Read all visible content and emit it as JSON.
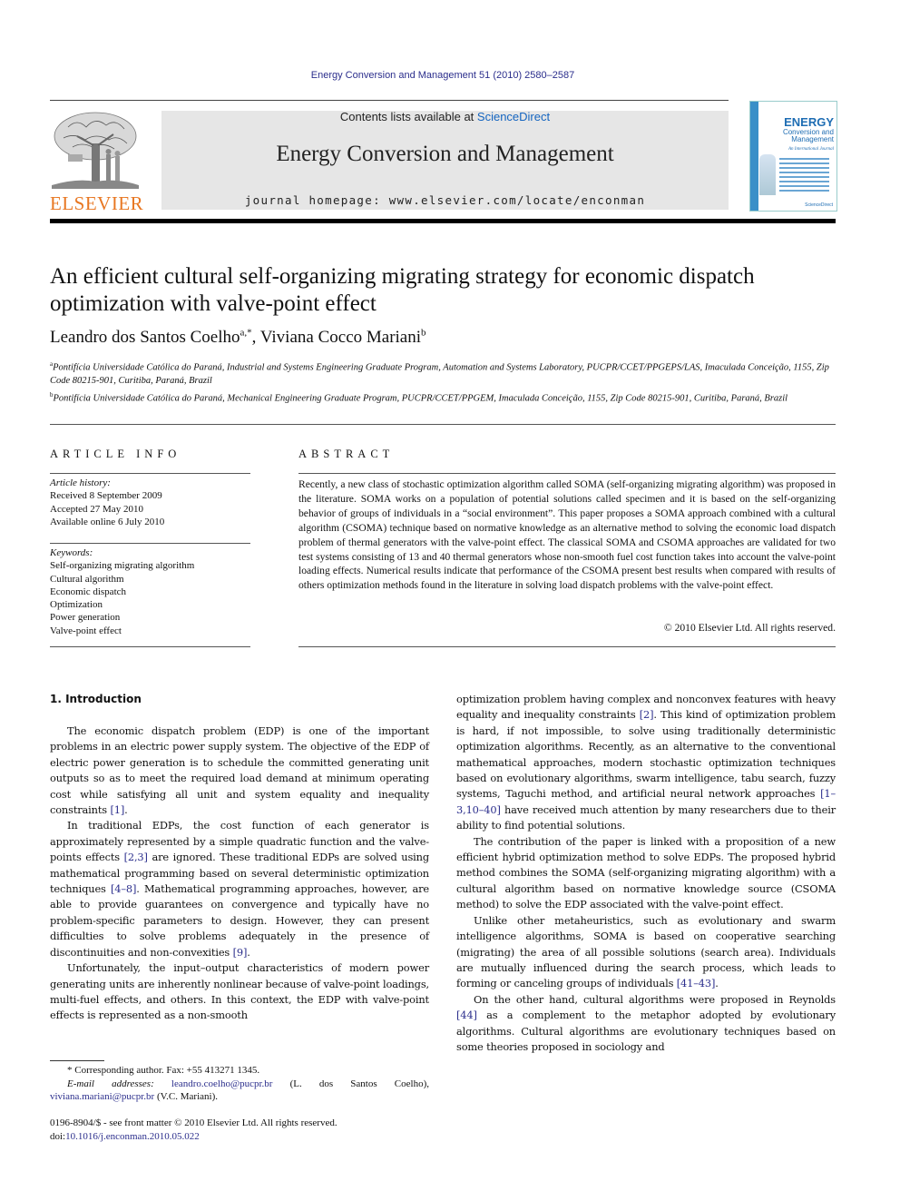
{
  "header": {
    "journal_reference": "Energy Conversion and Management 51 (2010) 2580–2587",
    "contents_prefix": "Contents lists available at ",
    "contents_link": "ScienceDirect",
    "journal_name": "Energy Conversion and Management",
    "homepage_label": "journal homepage: www.elsevier.com/locate/enconman",
    "publisher_logo_text": "ELSEVIER",
    "cover": {
      "title": "ENERGY",
      "subtitle_1": "Conversion and",
      "subtitle_2": "Management",
      "tagline": "An International Journal",
      "publisher_mark": "ScienceDirect"
    },
    "colors": {
      "link": "#2b2e8c",
      "sciencedirect": "#1565c0",
      "elsevier_orange": "#e87722",
      "masthead_bg": "#e6e6e6"
    }
  },
  "article": {
    "title": "An efficient cultural self-organizing migrating strategy for economic dispatch optimization with valve-point effect",
    "authors": [
      {
        "name": "Leandro dos Santos Coelho",
        "sup": "a,*"
      },
      {
        "name": "Viviana Cocco Mariani",
        "sup": "b"
      }
    ],
    "author_separator": ", ",
    "affiliations": [
      {
        "sup": "a",
        "text": "Pontifícia Universidade Católica do Paraná, Industrial and Systems Engineering Graduate Program, Automation and Systems Laboratory, PUCPR/CCET/PPGEPS/LAS, Imaculada Conceição, 1155, Zip Code 80215-901, Curitiba, Paraná, Brazil"
      },
      {
        "sup": "b",
        "text": "Pontifícia Universidade Católica do Paraná, Mechanical Engineering Graduate Program, PUCPR/CCET/PPGEM, Imaculada Conceição, 1155, Zip Code 80215-901, Curitiba, Paraná, Brazil"
      }
    ]
  },
  "article_info": {
    "heading": "ARTICLE INFO",
    "history_label": "Article history:",
    "history": [
      "Received 8 September 2009",
      "Accepted 27 May 2010",
      "Available online 6 July 2010"
    ],
    "keywords_label": "Keywords:",
    "keywords": [
      "Self-organizing migrating algorithm",
      "Cultural algorithm",
      "Economic dispatch",
      "Optimization",
      "Power generation",
      "Valve-point effect"
    ]
  },
  "abstract": {
    "heading": "ABSTRACT",
    "text": "Recently, a new class of stochastic optimization algorithm called SOMA (self-organizing migrating algorithm) was proposed in the literature. SOMA works on a population of potential solutions called specimen and it is based on the self-organizing behavior of groups of individuals in a “social environment”. This paper proposes a SOMA approach combined with a cultural algorithm (CSOMA) technique based on normative knowledge as an alternative method to solving the economic load dispatch problem of thermal generators with the valve-point effect. The classical SOMA and CSOMA approaches are validated for two test systems consisting of 13 and 40 thermal generators whose non-smooth fuel cost function takes into account the valve-point loading effects. Numerical results indicate that performance of the CSOMA present best results when compared with results of others optimization methods found in the literature in solving load dispatch problems with the valve-point effect.",
    "copyright": "© 2010 Elsevier Ltd. All rights reserved."
  },
  "introduction": {
    "heading": "1. Introduction",
    "left_paragraphs": [
      {
        "before": "The economic dispatch problem (EDP) is one of the important problems in an electric power supply system. The objective of the EDP of electric power generation is to schedule the committed generating unit outputs so as to meet the required load demand at minimum operating cost while satisfying all unit and system equality and inequality constraints ",
        "cite": "[1]",
        "after": "."
      },
      {
        "before": "In traditional EDPs, the cost function of each generator is approximately represented by a simple quadratic function and the valve-points effects ",
        "cite": "[2,3]",
        "middle": " are ignored. These traditional EDPs are solved using mathematical programming based on several deterministic optimization techniques ",
        "cite2": "[4–8]",
        "middle2": ". Mathematical programming approaches, however, are able to provide guarantees on convergence and typically have no problem-specific parameters to design. However, they can present difficulties to solve problems adequately in the presence of discontinuities and non-convexities ",
        "cite3": "[9]",
        "after": "."
      },
      {
        "before": "Unfortunately, the input–output characteristics of modern power generating units are inherently nonlinear because of valve-point loadings, multi-fuel effects, and others. In this context, the EDP with valve-point effects is represented as a non-smooth"
      }
    ],
    "right_paragraphs": [
      {
        "before": "optimization problem having complex and nonconvex features with heavy equality and inequality constraints ",
        "cite": "[2]",
        "middle": ". This kind of optimization problem is hard, if not impossible, to solve using traditionally deterministic optimization algorithms. Recently, as an alternative to the conventional mathematical approaches, modern stochastic optimization techniques based on evolutionary algorithms, swarm intelligence, tabu search, fuzzy systems, Taguchi method, and artificial neural network approaches ",
        "cite2": "[1–3,10–40]",
        "after": " have received much attention by many researchers due to their ability to find potential solutions."
      },
      {
        "before": "The contribution of the paper is linked with a proposition of a new efficient hybrid optimization method to solve EDPs. The proposed hybrid method combines the SOMA (self-organizing migrating algorithm) with a cultural algorithm based on normative knowledge source (CSOMA method) to solve the EDP associated with the valve-point effect."
      },
      {
        "before": "Unlike other metaheuristics, such as evolutionary and swarm intelligence algorithms, SOMA is based on cooperative searching (migrating) the area of all possible solutions (search area). Individuals are mutually influenced during the search process, which leads to forming or canceling groups of individuals ",
        "cite": "[41–43]",
        "after": "."
      },
      {
        "before": "On the other hand, cultural algorithms were proposed in Reynolds ",
        "cite": "[44]",
        "after": " as a complement to the metaphor adopted by evolutionary algorithms. Cultural algorithms are evolutionary techniques based on some theories proposed in sociology and"
      }
    ]
  },
  "footnotes": {
    "corresponding": "* Corresponding author. Fax: +55 413271 1345.",
    "email_label": "E-mail addresses:",
    "email_1": "leandro.coelho@pucpr.br",
    "email_1_owner": " (L. dos Santos Coelho), ",
    "email_2": "viviana.mariani@pucpr.br",
    "email_2_owner": " (V.C. Mariani).",
    "issn_line": "0196-8904/$ - see front matter © 2010 Elsevier Ltd. All rights reserved.",
    "doi_prefix": "doi:",
    "doi": "10.1016/j.enconman.2010.05.022"
  }
}
